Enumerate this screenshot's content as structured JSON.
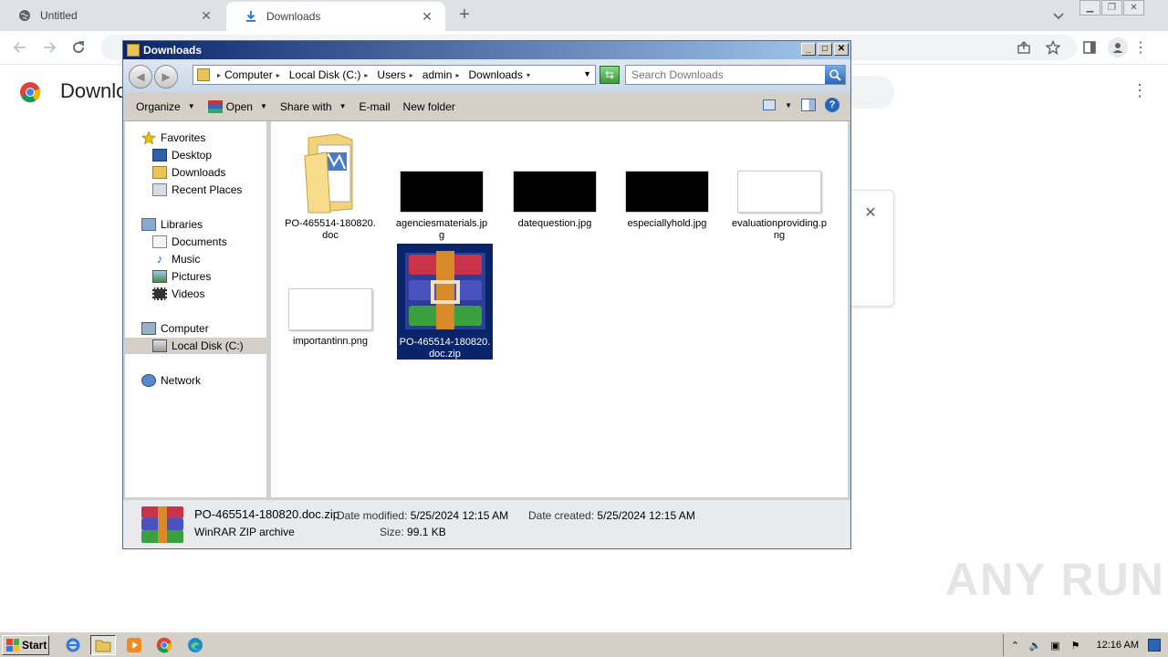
{
  "chrome": {
    "tabs": [
      {
        "title": "Untitled",
        "icon": "globe-icon",
        "active": false
      },
      {
        "title": "Downloads",
        "icon": "download-icon",
        "active": true
      }
    ],
    "new_tab_symbol": "+",
    "page_title": "Downlo",
    "menu_symbol": "⋮",
    "card_close_symbol": "✕"
  },
  "explorer": {
    "title": "Downloads",
    "breadcrumb": [
      "Computer",
      "Local Disk (C:)",
      "Users",
      "admin",
      "Downloads"
    ],
    "search_placeholder": "Search Downloads",
    "commands": {
      "organize": "Organize",
      "open": "Open",
      "share_with": "Share with",
      "email": "E-mail",
      "new_folder": "New folder"
    },
    "nav": {
      "favorites": "Favorites",
      "desktop": "Desktop",
      "downloads": "Downloads",
      "recent_places": "Recent Places",
      "libraries": "Libraries",
      "documents": "Documents",
      "music": "Music",
      "pictures": "Pictures",
      "videos": "Videos",
      "computer": "Computer",
      "local_disk": "Local Disk (C:)",
      "network": "Network"
    },
    "files": [
      {
        "name": "PO-465514-180820.doc",
        "type": "folder-doc"
      },
      {
        "name": "agenciesmaterials.jpg",
        "type": "black-thumb"
      },
      {
        "name": "datequestion.jpg",
        "type": "black-thumb"
      },
      {
        "name": "especiallyhold.jpg",
        "type": "black-thumb"
      },
      {
        "name": "evaluationproviding.png",
        "type": "white-thumb"
      },
      {
        "name": "importantinn.png",
        "type": "white-thumb"
      },
      {
        "name": "PO-465514-180820.doc.zip",
        "type": "winrar",
        "selected": true
      }
    ],
    "details": {
      "filename": "PO-465514-180820.doc.zip",
      "filetype": "WinRAR ZIP archive",
      "date_modified_label": "Date modified:",
      "date_modified": "5/25/2024 12:15 AM",
      "date_created_label": "Date created:",
      "date_created": "5/25/2024 12:15 AM",
      "size_label": "Size:",
      "size": "99.1 KB"
    }
  },
  "taskbar": {
    "start_label": "Start",
    "clock": "12:16 AM"
  },
  "watermark": "ANY RUN"
}
